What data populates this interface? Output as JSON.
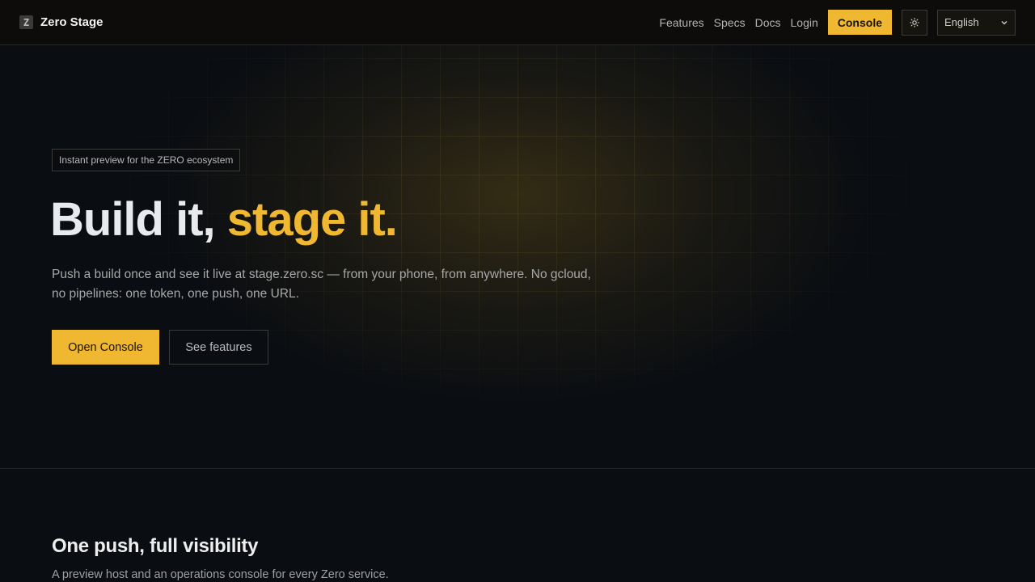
{
  "nav": {
    "brand_logo": "Z",
    "brand_name": "Zero Stage",
    "links": [
      "Features",
      "Specs",
      "Docs",
      "Login"
    ],
    "console_label": "Console",
    "theme_icon": "sun-icon",
    "language": "English"
  },
  "hero": {
    "badge": "Instant preview for the ZERO ecosystem",
    "headline_part1": "Build it, ",
    "headline_part2": "stage it.",
    "lead": "Push a build once and see it live at stage.zero.sc — from your phone, from anywhere. No gcloud, no pipelines: one token, one push, one URL.",
    "primary_cta": "Open Console",
    "secondary_cta": "See features"
  },
  "section": {
    "title": "One push, full visibility",
    "subtitle": "A preview host and an operations console for every Zero service."
  },
  "colors": {
    "accent": "#f0b730",
    "background": "#0a0d12"
  }
}
